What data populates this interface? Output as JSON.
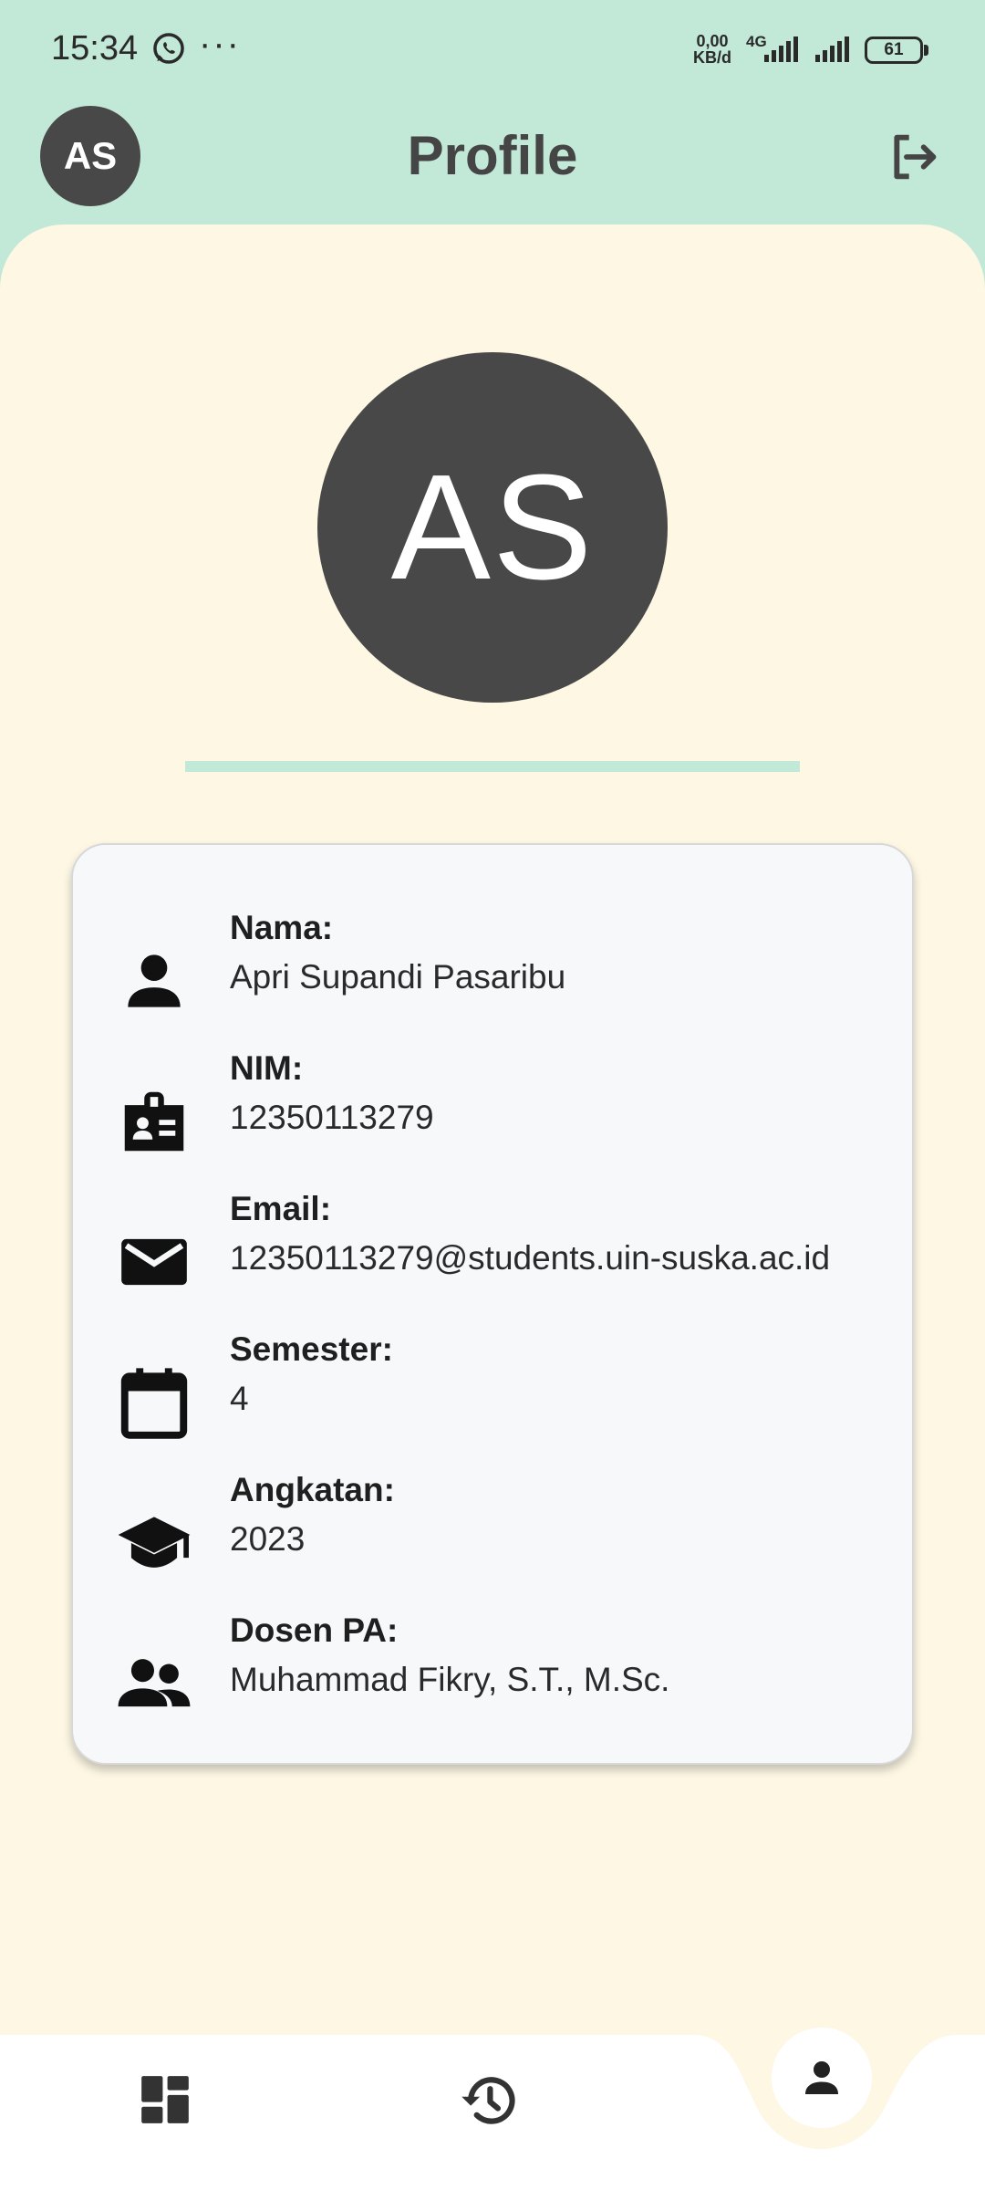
{
  "status_bar": {
    "time": "15:34",
    "net_speed_top": "0,00",
    "net_speed_bottom": "KB/d",
    "network_type": "4G",
    "battery": "61"
  },
  "app_bar": {
    "avatar_initials": "AS",
    "title": "Profile"
  },
  "profile": {
    "initials": "AS"
  },
  "info": [
    {
      "icon": "person-icon",
      "label": "Nama:",
      "value": "Apri Supandi Pasaribu"
    },
    {
      "icon": "badge-icon",
      "label": "NIM:",
      "value": "12350113279"
    },
    {
      "icon": "email-icon",
      "label": "Email:",
      "value": "12350113279@students.uin-suska.ac.id"
    },
    {
      "icon": "calendar-icon",
      "label": "Semester:",
      "value": "4"
    },
    {
      "icon": "graduation-cap-icon",
      "label": "Angkatan:",
      "value": "2023"
    },
    {
      "icon": "people-icon",
      "label": "Dosen PA:",
      "value": "Muhammad Fikry, S.T., M.Sc."
    }
  ],
  "bottom_nav": {
    "items": [
      "dashboard-icon",
      "history-icon",
      "person-icon"
    ],
    "active": "person-icon"
  },
  "colors": {
    "header_bg": "#c2e8d8",
    "sheet_bg": "#fdf7e4",
    "avatar_bg": "#484848",
    "card_bg": "#f7f8fa",
    "accent_line": "#c2e8d8"
  }
}
